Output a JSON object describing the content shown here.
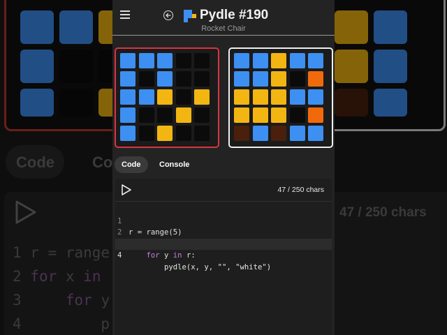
{
  "header": {
    "title": "Pydle #190",
    "subtitle": "Rocket Chair"
  },
  "colors": {
    "blue": "#3d8ff2",
    "black": "#0b0b0b",
    "yellow": "#f3b512",
    "orange": "#f06a0c",
    "brown": "#4a1f0b",
    "target_border": "#d9343f",
    "result_border": "#f0f0f0"
  },
  "boards": {
    "target": [
      [
        "blue",
        "blue",
        "blue",
        "black",
        "black"
      ],
      [
        "blue",
        "black",
        "blue",
        "black",
        "black"
      ],
      [
        "blue",
        "blue",
        "yellow",
        "black",
        "yellow"
      ],
      [
        "blue",
        "black",
        "black",
        "yellow",
        "black"
      ],
      [
        "blue",
        "black",
        "yellow",
        "black",
        "black"
      ]
    ],
    "result": [
      [
        "blue",
        "blue",
        "yellow",
        "blue",
        "blue"
      ],
      [
        "blue",
        "blue",
        "yellow",
        "black",
        "orange"
      ],
      [
        "yellow",
        "yellow",
        "yellow",
        "blue",
        "blue"
      ],
      [
        "yellow",
        "yellow",
        "yellow",
        "black",
        "orange"
      ],
      [
        "brown",
        "blue",
        "brown",
        "blue",
        "blue"
      ]
    ]
  },
  "tabs": {
    "code": "Code",
    "console": "Console"
  },
  "editor": {
    "char_count": "47 / 250 chars",
    "line_numbers": [
      "1",
      "2",
      "3",
      "4"
    ],
    "lines": [
      {
        "kw1": "",
        "text": "r = range(5)"
      },
      {
        "kw1": "for",
        "mid": " x ",
        "kw2": "in",
        "rest": " r:"
      },
      {
        "indent": "    ",
        "kw1": "for",
        "mid": " y ",
        "kw2": "in",
        "rest": " r:"
      },
      {
        "indent": "        ",
        "text": "pydle(x, y, \"\", \"white\")"
      }
    ],
    "active_line": 4
  }
}
